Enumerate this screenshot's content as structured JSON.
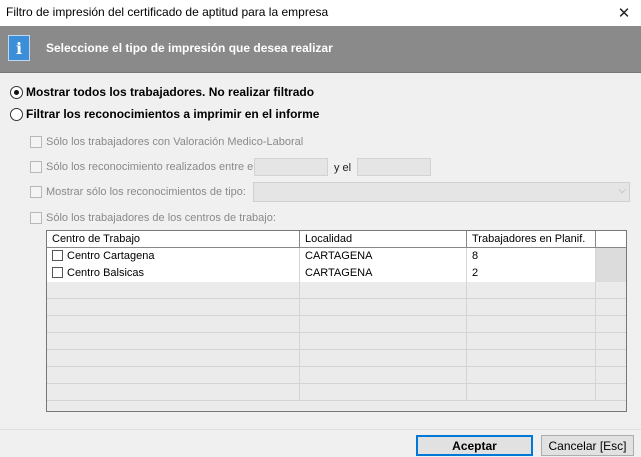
{
  "window": {
    "title": "Filtro de impresión del certificado de aptitud para la empresa",
    "close_glyph": "✕"
  },
  "banner": {
    "icon": "info-icon",
    "icon_glyph": "i",
    "text": "Seleccione el tipo de impresión que desea realizar"
  },
  "radios": {
    "show_all": {
      "label": "Mostrar todos los trabajadores. No realizar filtrado",
      "checked": true
    },
    "filter": {
      "label": "Filtrar los reconocimientos a imprimir en el informe",
      "checked": false
    }
  },
  "filters": {
    "valoracion": "Sólo los trabajadores con Valoración Medico-Laboral",
    "fecha": "Sólo los reconocimiento realizados entre el",
    "fecha_and": "y el",
    "fecha_from": "",
    "fecha_to": "",
    "tipo": "Mostrar sólo los reconocimientos de tipo:",
    "tipo_value": "",
    "centros": "Sólo los trabajadores de los centros de trabajo:"
  },
  "grid": {
    "columns": [
      "Centro de Trabajo",
      "Localidad",
      "Trabajadores en Planif."
    ],
    "rows": [
      {
        "centro": "Centro Cartagena",
        "localidad": "CARTAGENA",
        "trabajadores": "8"
      },
      {
        "centro": "Centro Balsicas",
        "localidad": "CARTAGENA",
        "trabajadores": "2"
      }
    ]
  },
  "buttons": {
    "accept": "Aceptar",
    "cancel": "Cancelar [Esc]"
  }
}
